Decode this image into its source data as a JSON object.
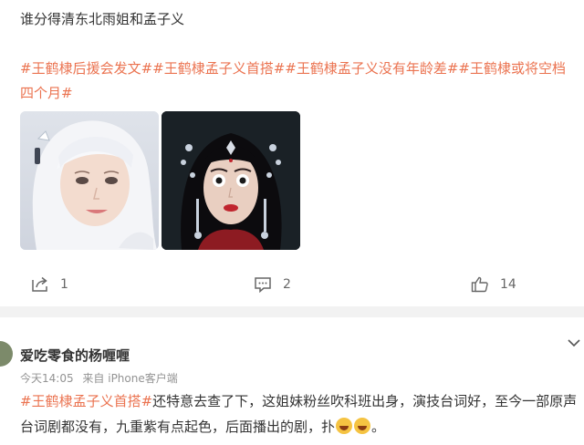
{
  "post": {
    "text": "谁分得清东北雨姐和孟子义",
    "tags": [
      "#王鹤棣后援会发文#",
      "#王鹤棣孟子义首搭#",
      "#王鹤棣孟子义没有年龄差#",
      "#王鹤棣或将空档四个月#"
    ],
    "actions": {
      "share_count": "1",
      "comment_count": "2",
      "like_count": "14"
    }
  },
  "comment": {
    "username": "爱吃零食的杨喱喱",
    "time": "今天14:05",
    "source": "来自 iPhone客户端",
    "tag": "#王鹤棣孟子义首搭#",
    "text": "还特意去查了下，这姐妹粉丝吹科班出身，演技台词好，至今一部原声台词剧都没有，九重紫有点起色，后面播出的剧，扑",
    "trailing": "。"
  },
  "colors": {
    "accent": "#eb7350",
    "muted": "#939393",
    "gap": "#f2f2f2"
  }
}
